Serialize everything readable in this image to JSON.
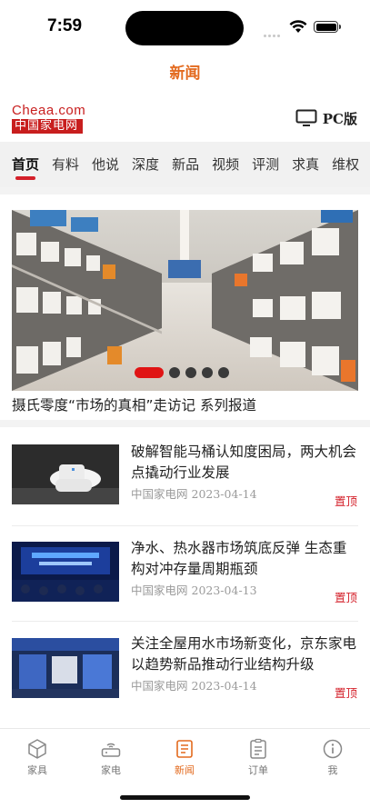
{
  "status": {
    "time": "7:59"
  },
  "nav": {
    "title": "新闻"
  },
  "header": {
    "logo_top": "Cheaa.com",
    "logo_bottom": "中国家电网",
    "pc_label": "PC版"
  },
  "tabs": [
    {
      "label": "首页",
      "active": true
    },
    {
      "label": "有料"
    },
    {
      "label": "他说"
    },
    {
      "label": "深度"
    },
    {
      "label": "新品"
    },
    {
      "label": "视频"
    },
    {
      "label": "评测"
    },
    {
      "label": "求真"
    },
    {
      "label": "维权"
    }
  ],
  "banner": {
    "caption": "摄氏零度“市场的真相”走访记 系列报道",
    "slide_count": 5,
    "active_slide": 1
  },
  "news": [
    {
      "title": "破解智能马桶认知度困局，两大机会点撬动行业发展",
      "source": "中国家电网",
      "date": "2023-04-14",
      "tag": "置顶"
    },
    {
      "title": "净水、热水器市场筑底反弹 生态重构对冲存量周期瓶颈",
      "source": "中国家电网",
      "date": "2023-04-13",
      "tag": "置顶"
    },
    {
      "title": "关注全屋用水市场新变化，京东家电以趋势新品推动行业结构升级",
      "source": "中国家电网",
      "date": "2023-04-14",
      "tag": "置顶"
    }
  ],
  "tabbar": [
    {
      "label": "家具",
      "icon": "cube-icon"
    },
    {
      "label": "家电",
      "icon": "router-icon"
    },
    {
      "label": "新闻",
      "icon": "news-icon",
      "active": true
    },
    {
      "label": "订单",
      "icon": "order-icon"
    },
    {
      "label": "我",
      "icon": "info-icon"
    }
  ],
  "colors": {
    "accent": "#e36a1e",
    "brand_red": "#d4202a",
    "tab_bg": "#f1f1f1"
  }
}
